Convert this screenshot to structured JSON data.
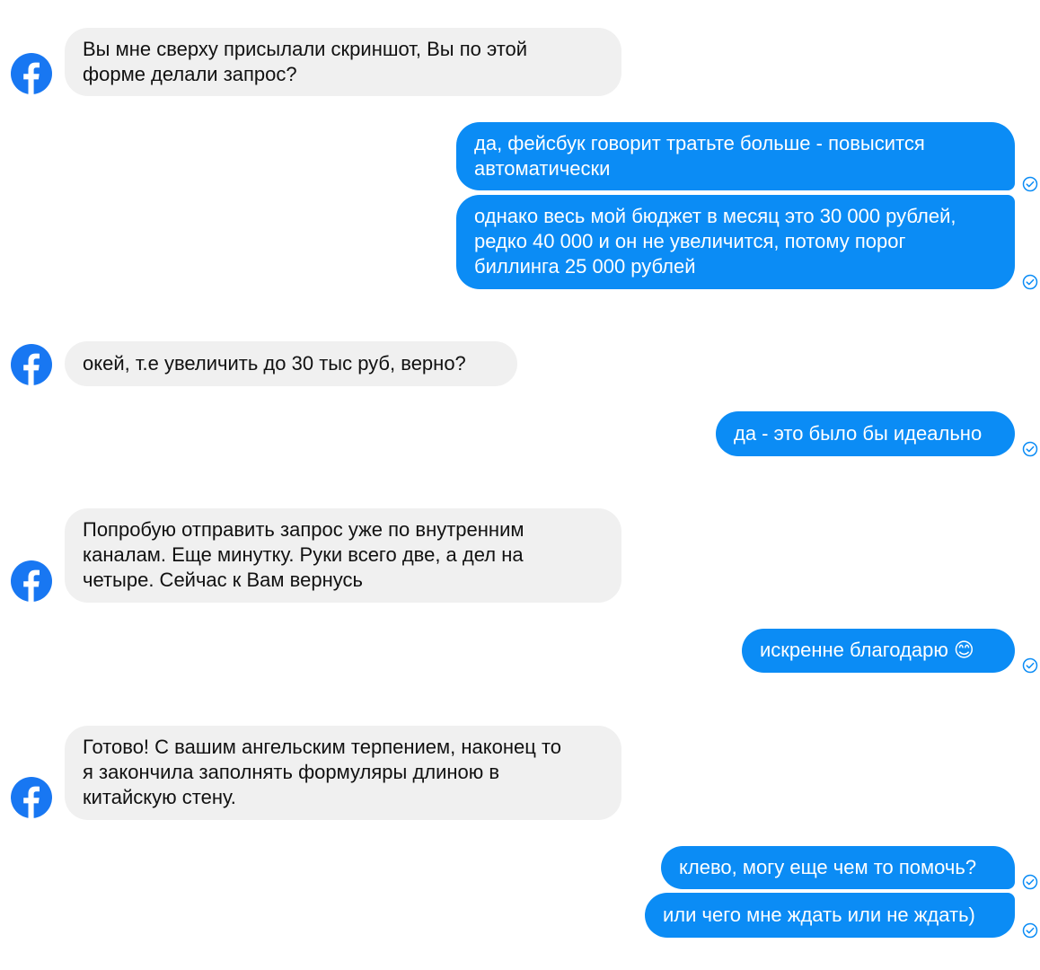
{
  "theme": {
    "incoming_bubble": "#f0f0f0",
    "outgoing_bubble": "#0b8cf5",
    "brand": "#1877f2",
    "read_check": "#0b8cf5"
  },
  "sender_avatar_icon": "facebook-logo-icon",
  "read_receipt_icon": "check-circle-icon",
  "messages": [
    {
      "direction": "incoming",
      "text": "Вы мне сверху присылали скриншот, Вы по этой\nформе делали запрос?"
    },
    {
      "direction": "outgoing",
      "text": "да, фейсбук говорит тратьте больше - повысится\nавтоматически"
    },
    {
      "direction": "outgoing",
      "text": "однако весь мой бюджет в месяц это 30 000 рублей,\nредко 40 000 и он не увеличится, потому порог\nбиллинга 25 000 рублей"
    },
    {
      "direction": "incoming",
      "text": "окей, т.е  увеличить до 30 тыс руб, верно?"
    },
    {
      "direction": "outgoing",
      "text": "да - это было бы идеально"
    },
    {
      "direction": "incoming",
      "text": "Попробую отправить запрос уже по внутренним\nканалам. Еще минутку. Руки всего две, а дел на\nчетыре. Сейчас к Вам вернусь"
    },
    {
      "direction": "outgoing",
      "text": "искренне благодарю 😊"
    },
    {
      "direction": "incoming",
      "text": "Готово! С вашим ангельским терпением, наконец то\nя закончила заполнять формуляры длиною в\nкитайскую стену."
    },
    {
      "direction": "outgoing",
      "text": "клево, могу еще чем то помочь?"
    },
    {
      "direction": "outgoing",
      "text": "или чего мне ждать или не ждать)"
    }
  ]
}
